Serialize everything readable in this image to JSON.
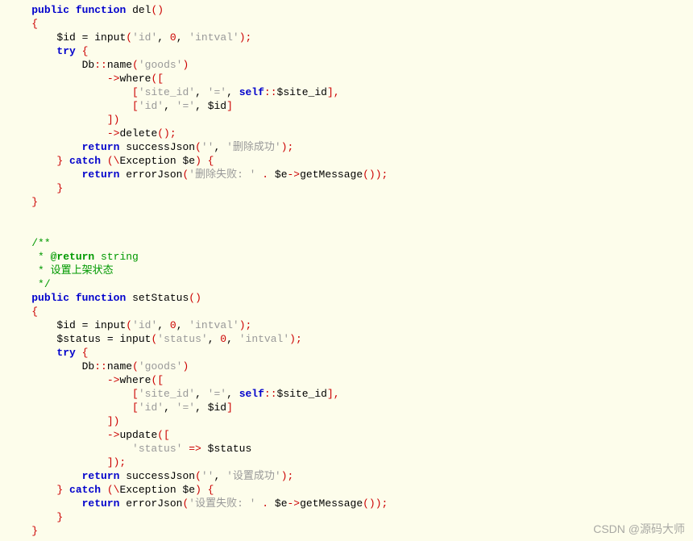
{
  "code": {
    "l01": {
      "kw_public": "public",
      "kw_function": "function",
      "fn": "del",
      "paren": "()"
    },
    "l02": {
      "brace": "{"
    },
    "l03": {
      "var": "$id",
      "assign": " = ",
      "fn": "input",
      "open": "(",
      "s1": "'id'",
      "c1": ", ",
      "n": "0",
      "c2": ", ",
      "s2": "'intval'",
      "close": ");"
    },
    "l04": {
      "kw": "try",
      "brace": " {"
    },
    "l05": {
      "db": "Db",
      "dcolon": "::",
      "name": "name",
      "open": "(",
      "s": "'goods'",
      "close": ")"
    },
    "l06": {
      "arrow": "->",
      "where": "where",
      "open": "(["
    },
    "l07": {
      "open": "[",
      "s1": "'site_id'",
      "c1": ", ",
      "s2": "'='",
      "c2": ", ",
      "self": "self",
      "dcolon": "::",
      "var": "$site_id",
      "close": "],"
    },
    "l08": {
      "open": "[",
      "s1": "'id'",
      "c1": ", ",
      "s2": "'='",
      "c2": ", ",
      "var": "$id",
      "close": "]"
    },
    "l09": {
      "close": "])"
    },
    "l10": {
      "arrow": "->",
      "delete": "delete",
      "paren": "();"
    },
    "l11": {
      "kw": "return",
      "fn": " successJson",
      "open": "(",
      "s1": "''",
      "c": ", ",
      "s2": "'删除成功'",
      "close": ");"
    },
    "l12": {
      "brace": "}",
      "kw": " catch ",
      "open": "(\\",
      "exc": "Exception",
      "var": " $e",
      "close": ") {"
    },
    "l13": {
      "kw": "return",
      "fn": " errorJson",
      "open": "(",
      "s1": "'删除失败: '",
      "dot": " . ",
      "var": "$e",
      "arrow": "->",
      "get": "getMessage",
      "close": "());"
    },
    "l14": {
      "brace": "}"
    },
    "l15": {
      "brace": "}"
    },
    "l16": {
      "txt": ""
    },
    "l17": {
      "txt": ""
    },
    "l18": {
      "txt": "/**"
    },
    "l19": {
      "pre": " * ",
      "at": "@return",
      "tail": " string"
    },
    "l20": {
      "txt": " * 设置上架状态"
    },
    "l21": {
      "txt": " */"
    },
    "l22": {
      "kw_public": "public",
      "kw_function": "function",
      "fn": "setStatus",
      "paren": "()"
    },
    "l23": {
      "brace": "{"
    },
    "l24": {
      "var": "$id",
      "assign": " = ",
      "fn": "input",
      "open": "(",
      "s1": "'id'",
      "c1": ", ",
      "n": "0",
      "c2": ", ",
      "s2": "'intval'",
      "close": ");"
    },
    "l25": {
      "var": "$status",
      "assign": " = ",
      "fn": "input",
      "open": "(",
      "s1": "'status'",
      "c1": ", ",
      "n": "0",
      "c2": ", ",
      "s2": "'intval'",
      "close": ");"
    },
    "l26": {
      "kw": "try",
      "brace": " {"
    },
    "l27": {
      "db": "Db",
      "dcolon": "::",
      "name": "name",
      "open": "(",
      "s": "'goods'",
      "close": ")"
    },
    "l28": {
      "arrow": "->",
      "where": "where",
      "open": "(["
    },
    "l29": {
      "open": "[",
      "s1": "'site_id'",
      "c1": ", ",
      "s2": "'='",
      "c2": ", ",
      "self": "self",
      "dcolon": "::",
      "var": "$site_id",
      "close": "],"
    },
    "l30": {
      "open": "[",
      "s1": "'id'",
      "c1": ", ",
      "s2": "'='",
      "c2": ", ",
      "var": "$id",
      "close": "]"
    },
    "l31": {
      "close": "])"
    },
    "l32": {
      "arrow": "->",
      "update": "update",
      "open": "(["
    },
    "l33": {
      "s": "'status'",
      "arrow": " => ",
      "var": "$status"
    },
    "l34": {
      "close": "]);"
    },
    "l35": {
      "kw": "return",
      "fn": " successJson",
      "open": "(",
      "s1": "''",
      "c": ", ",
      "s2": "'设置成功'",
      "close": ");"
    },
    "l36": {
      "brace": "}",
      "kw": " catch ",
      "open": "(\\",
      "exc": "Exception",
      "var": " $e",
      "close": ") {"
    },
    "l37": {
      "kw": "return",
      "fn": " errorJson",
      "open": "(",
      "s1": "'设置失败: '",
      "dot": " . ",
      "var": "$e",
      "arrow": "->",
      "get": "getMessage",
      "close": "());"
    },
    "l38": {
      "brace": "}"
    },
    "l39": {
      "brace": "}"
    }
  },
  "watermark": "CSDN @源码大师"
}
